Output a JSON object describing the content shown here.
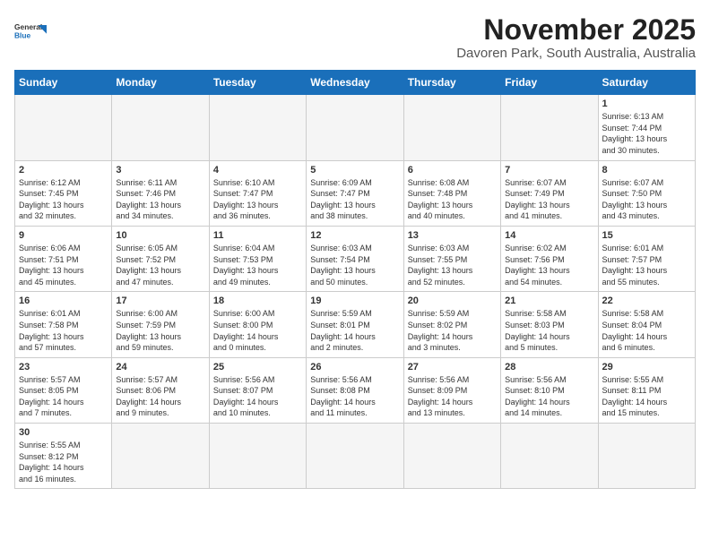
{
  "header": {
    "logo_general": "General",
    "logo_blue": "Blue",
    "month": "November 2025",
    "location": "Davoren Park, South Australia, Australia"
  },
  "weekdays": [
    "Sunday",
    "Monday",
    "Tuesday",
    "Wednesday",
    "Thursday",
    "Friday",
    "Saturday"
  ],
  "weeks": [
    [
      {
        "day": "",
        "info": ""
      },
      {
        "day": "",
        "info": ""
      },
      {
        "day": "",
        "info": ""
      },
      {
        "day": "",
        "info": ""
      },
      {
        "day": "",
        "info": ""
      },
      {
        "day": "",
        "info": ""
      },
      {
        "day": "1",
        "info": "Sunrise: 6:13 AM\nSunset: 7:44 PM\nDaylight: 13 hours\nand 30 minutes."
      }
    ],
    [
      {
        "day": "2",
        "info": "Sunrise: 6:12 AM\nSunset: 7:45 PM\nDaylight: 13 hours\nand 32 minutes."
      },
      {
        "day": "3",
        "info": "Sunrise: 6:11 AM\nSunset: 7:46 PM\nDaylight: 13 hours\nand 34 minutes."
      },
      {
        "day": "4",
        "info": "Sunrise: 6:10 AM\nSunset: 7:47 PM\nDaylight: 13 hours\nand 36 minutes."
      },
      {
        "day": "5",
        "info": "Sunrise: 6:09 AM\nSunset: 7:47 PM\nDaylight: 13 hours\nand 38 minutes."
      },
      {
        "day": "6",
        "info": "Sunrise: 6:08 AM\nSunset: 7:48 PM\nDaylight: 13 hours\nand 40 minutes."
      },
      {
        "day": "7",
        "info": "Sunrise: 6:07 AM\nSunset: 7:49 PM\nDaylight: 13 hours\nand 41 minutes."
      },
      {
        "day": "8",
        "info": "Sunrise: 6:07 AM\nSunset: 7:50 PM\nDaylight: 13 hours\nand 43 minutes."
      }
    ],
    [
      {
        "day": "9",
        "info": "Sunrise: 6:06 AM\nSunset: 7:51 PM\nDaylight: 13 hours\nand 45 minutes."
      },
      {
        "day": "10",
        "info": "Sunrise: 6:05 AM\nSunset: 7:52 PM\nDaylight: 13 hours\nand 47 minutes."
      },
      {
        "day": "11",
        "info": "Sunrise: 6:04 AM\nSunset: 7:53 PM\nDaylight: 13 hours\nand 49 minutes."
      },
      {
        "day": "12",
        "info": "Sunrise: 6:03 AM\nSunset: 7:54 PM\nDaylight: 13 hours\nand 50 minutes."
      },
      {
        "day": "13",
        "info": "Sunrise: 6:03 AM\nSunset: 7:55 PM\nDaylight: 13 hours\nand 52 minutes."
      },
      {
        "day": "14",
        "info": "Sunrise: 6:02 AM\nSunset: 7:56 PM\nDaylight: 13 hours\nand 54 minutes."
      },
      {
        "day": "15",
        "info": "Sunrise: 6:01 AM\nSunset: 7:57 PM\nDaylight: 13 hours\nand 55 minutes."
      }
    ],
    [
      {
        "day": "16",
        "info": "Sunrise: 6:01 AM\nSunset: 7:58 PM\nDaylight: 13 hours\nand 57 minutes."
      },
      {
        "day": "17",
        "info": "Sunrise: 6:00 AM\nSunset: 7:59 PM\nDaylight: 13 hours\nand 59 minutes."
      },
      {
        "day": "18",
        "info": "Sunrise: 6:00 AM\nSunset: 8:00 PM\nDaylight: 14 hours\nand 0 minutes."
      },
      {
        "day": "19",
        "info": "Sunrise: 5:59 AM\nSunset: 8:01 PM\nDaylight: 14 hours\nand 2 minutes."
      },
      {
        "day": "20",
        "info": "Sunrise: 5:59 AM\nSunset: 8:02 PM\nDaylight: 14 hours\nand 3 minutes."
      },
      {
        "day": "21",
        "info": "Sunrise: 5:58 AM\nSunset: 8:03 PM\nDaylight: 14 hours\nand 5 minutes."
      },
      {
        "day": "22",
        "info": "Sunrise: 5:58 AM\nSunset: 8:04 PM\nDaylight: 14 hours\nand 6 minutes."
      }
    ],
    [
      {
        "day": "23",
        "info": "Sunrise: 5:57 AM\nSunset: 8:05 PM\nDaylight: 14 hours\nand 7 minutes."
      },
      {
        "day": "24",
        "info": "Sunrise: 5:57 AM\nSunset: 8:06 PM\nDaylight: 14 hours\nand 9 minutes."
      },
      {
        "day": "25",
        "info": "Sunrise: 5:56 AM\nSunset: 8:07 PM\nDaylight: 14 hours\nand 10 minutes."
      },
      {
        "day": "26",
        "info": "Sunrise: 5:56 AM\nSunset: 8:08 PM\nDaylight: 14 hours\nand 11 minutes."
      },
      {
        "day": "27",
        "info": "Sunrise: 5:56 AM\nSunset: 8:09 PM\nDaylight: 14 hours\nand 13 minutes."
      },
      {
        "day": "28",
        "info": "Sunrise: 5:56 AM\nSunset: 8:10 PM\nDaylight: 14 hours\nand 14 minutes."
      },
      {
        "day": "29",
        "info": "Sunrise: 5:55 AM\nSunset: 8:11 PM\nDaylight: 14 hours\nand 15 minutes."
      }
    ],
    [
      {
        "day": "30",
        "info": "Sunrise: 5:55 AM\nSunset: 8:12 PM\nDaylight: 14 hours\nand 16 minutes."
      },
      {
        "day": "",
        "info": ""
      },
      {
        "day": "",
        "info": ""
      },
      {
        "day": "",
        "info": ""
      },
      {
        "day": "",
        "info": ""
      },
      {
        "day": "",
        "info": ""
      },
      {
        "day": "",
        "info": ""
      }
    ]
  ]
}
